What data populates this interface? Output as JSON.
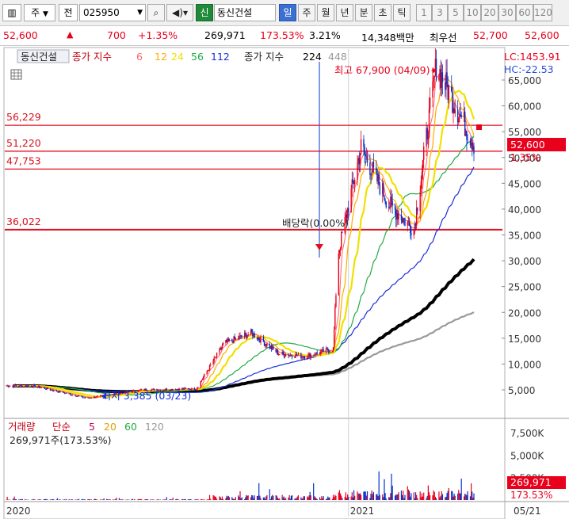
{
  "toolbar": {
    "market": "주",
    "info_label": "전",
    "code": "025950",
    "company_badge": "신",
    "company_name": "동신건설",
    "periods": [
      "일",
      "주",
      "월",
      "년",
      "분",
      "초",
      "틱"
    ],
    "active_period": "일",
    "intervals": [
      "1",
      "3",
      "5",
      "10",
      "20",
      "30",
      "60",
      "120"
    ]
  },
  "quote": {
    "price": "52,600",
    "change": "700",
    "change_pct": "+1.35%",
    "volume": "269,971",
    "volume_ratio": "173.53%",
    "turnover_pct": "3.21%",
    "amount": "14,348백만",
    "best_label": "최우선",
    "best_ask": "52,700",
    "best_bid": "52,600"
  },
  "colors": {
    "up": "#e8001c",
    "down": "#0033cc",
    "ma6": "#ff6666",
    "ma12": "#ffaa00",
    "ma24": "#f0e000",
    "ma56": "#22aa44",
    "ma112": "#1a2fd6",
    "ma224": "#000000",
    "ma448": "#999999"
  },
  "chart_data": [
    {
      "type": "line",
      "subtype": "candlestick",
      "legend": {
        "name": "동신건설",
        "indicator": "종가 지수",
        "periods": [
          "6",
          "12",
          "24",
          "56",
          "112",
          "224",
          "448"
        ]
      },
      "y_ticks": [
        "5,000",
        "10,000",
        "15,000",
        "20,000",
        "25,000",
        "30,000",
        "35,000",
        "40,000",
        "45,000",
        "50,000",
        "55,000",
        "60,000",
        "65,000"
      ],
      "ylim": [
        0,
        70000
      ],
      "right_labels": {
        "lc": "LC:1453.91",
        "hc": "HC:-22.53",
        "price": "52,600",
        "pct": "1.35%"
      },
      "hlines": [
        {
          "label": "56,229",
          "value": 56229
        },
        {
          "label": "51,220",
          "value": 51220
        },
        {
          "label": "47,753",
          "value": 47753
        },
        {
          "label": "36,022",
          "value": 36022
        }
      ],
      "annotations": {
        "high": "최고 67,900 (04/09)",
        "low": "최저 3,385 (03/23)",
        "dividend": "배당락(0.00%)"
      },
      "x_ticks": [
        "2020",
        "2021",
        "05/21"
      ],
      "close_approx": [
        {
          "date": "2020-01",
          "close": 5800
        },
        {
          "date": "2020-03",
          "close": 3385
        },
        {
          "date": "2020-05",
          "close": 5000
        },
        {
          "date": "2020-07",
          "close": 5200
        },
        {
          "date": "2020-08",
          "close": 14000
        },
        {
          "date": "2020-09",
          "close": 16000
        },
        {
          "date": "2020-10",
          "close": 12000
        },
        {
          "date": "2020-11",
          "close": 11500
        },
        {
          "date": "2020-12",
          "close": 13000
        },
        {
          "date": "2020-12-20",
          "close": 31000
        },
        {
          "date": "2021-01",
          "close": 52000
        },
        {
          "date": "2021-02",
          "close": 41000
        },
        {
          "date": "2021-03",
          "close": 36000
        },
        {
          "date": "2021-04-09",
          "close": 67900
        },
        {
          "date": "2021-05-21",
          "close": 52600
        }
      ]
    },
    {
      "type": "bar",
      "legend": {
        "name": "거래량",
        "indicator": "단순",
        "periods": [
          "5",
          "20",
          "60",
          "120"
        ]
      },
      "summary": "269,971주(173.53%)",
      "y_ticks": [
        "2,500K",
        "5,000K",
        "7,500K"
      ],
      "right_labels": {
        "value": "269,971",
        "pct": "173.53%"
      },
      "ylim": [
        0,
        8000000
      ]
    }
  ]
}
